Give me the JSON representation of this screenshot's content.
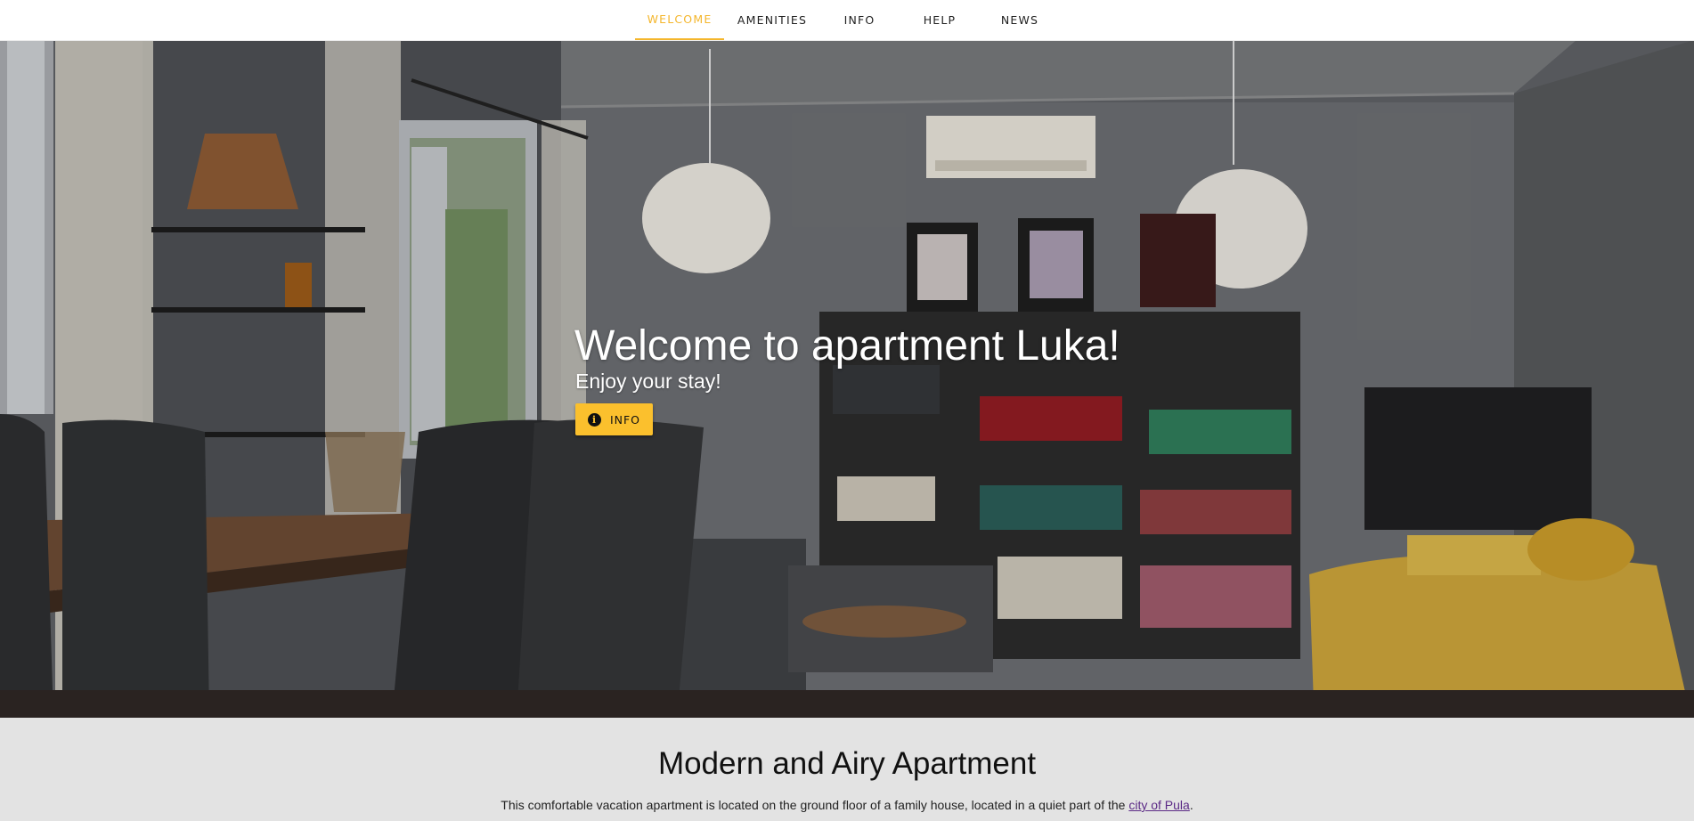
{
  "nav": {
    "items": [
      {
        "label": "WELCOME",
        "active": true
      },
      {
        "label": "AMENITIES",
        "active": false
      },
      {
        "label": "INFO",
        "active": false
      },
      {
        "label": "HELP",
        "active": false
      },
      {
        "label": "NEWS",
        "active": false
      }
    ],
    "accent_color": "#f4b62c"
  },
  "hero": {
    "title": "Welcome to apartment Luka!",
    "subtitle": "Enjoy your stay!",
    "button": {
      "label": "INFO",
      "icon": "info-icon",
      "color": "#fbc02d"
    }
  },
  "intro": {
    "title": "Modern and Airy Apartment",
    "text_before": "This comfortable vacation apartment is located on the ground floor of a family house, located in a quiet part of the ",
    "link_label": "city of Pula",
    "text_after": "."
  }
}
